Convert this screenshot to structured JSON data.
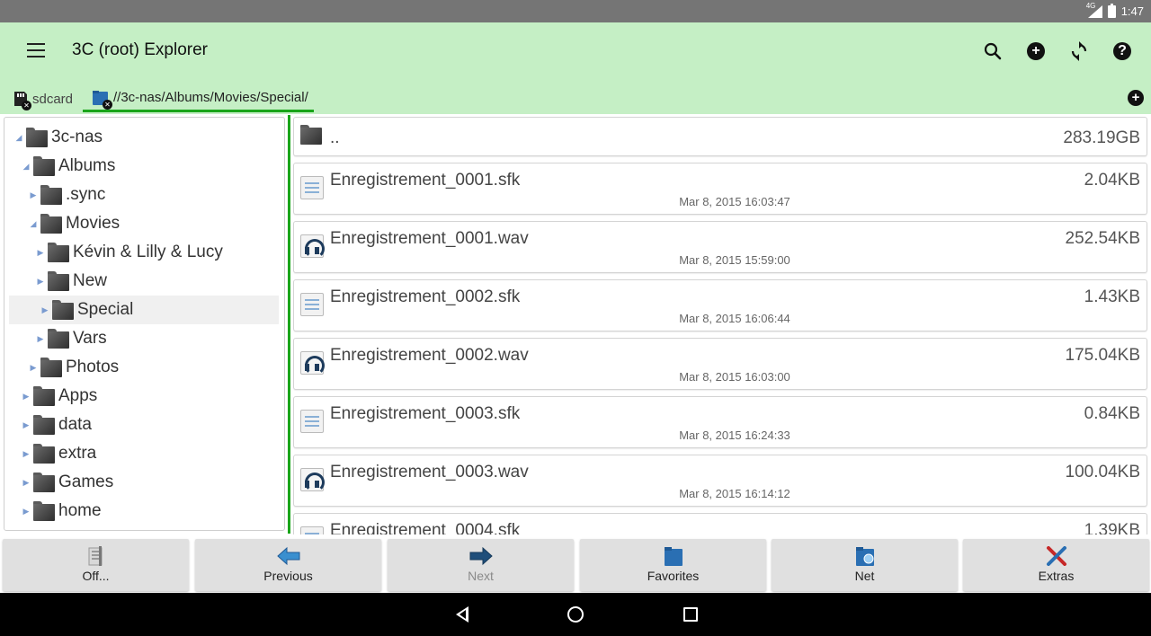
{
  "status_bar": {
    "network": "4G",
    "time": "1:47"
  },
  "app_bar": {
    "title": "3C (root) Explorer",
    "icons": [
      "menu-icon",
      "search-icon",
      "add-icon",
      "refresh-icon",
      "help-icon"
    ]
  },
  "tabs": [
    {
      "label": "sdcard"
    },
    {
      "label": "//3c-nas/Albums/Movies/Special/"
    }
  ],
  "tree": [
    {
      "label": "3c-nas",
      "expanded": true
    },
    {
      "label": "Albums",
      "expanded": true
    },
    {
      "label": ".sync",
      "expanded": false
    },
    {
      "label": "Movies",
      "expanded": true
    },
    {
      "label": "Kévin & Lilly & Lucy",
      "expanded": false
    },
    {
      "label": "New",
      "expanded": false
    },
    {
      "label": "Special",
      "expanded": false,
      "selected": true
    },
    {
      "label": "Vars",
      "expanded": false
    },
    {
      "label": "Photos",
      "expanded": false
    },
    {
      "label": "Apps",
      "expanded": false
    },
    {
      "label": "data",
      "expanded": false
    },
    {
      "label": "extra",
      "expanded": false
    },
    {
      "label": "Games",
      "expanded": false
    },
    {
      "label": "home",
      "expanded": false
    }
  ],
  "files": [
    {
      "name": "..",
      "size": "283.19GB",
      "date": "",
      "type": "folder"
    },
    {
      "name": "Enregistrement_0001.sfk",
      "size": "2.04KB",
      "date": "Mar 8, 2015 16:03:47",
      "type": "sfk"
    },
    {
      "name": "Enregistrement_0001.wav",
      "size": "252.54KB",
      "date": "Mar 8, 2015 15:59:00",
      "type": "wav"
    },
    {
      "name": "Enregistrement_0002.sfk",
      "size": "1.43KB",
      "date": "Mar 8, 2015 16:06:44",
      "type": "sfk"
    },
    {
      "name": "Enregistrement_0002.wav",
      "size": "175.04KB",
      "date": "Mar 8, 2015 16:03:00",
      "type": "wav"
    },
    {
      "name": "Enregistrement_0003.sfk",
      "size": "0.84KB",
      "date": "Mar 8, 2015 16:24:33",
      "type": "sfk"
    },
    {
      "name": "Enregistrement_0003.wav",
      "size": "100.04KB",
      "date": "Mar 8, 2015 16:14:12",
      "type": "wav"
    },
    {
      "name": "Enregistrement_0004.sfk",
      "size": "1.39KB",
      "date": "",
      "type": "sfk"
    }
  ],
  "bottom_buttons": [
    {
      "label": "Off...",
      "icon": "operations-icon",
      "enabled": true
    },
    {
      "label": "Previous",
      "icon": "arrow-left-icon",
      "enabled": true
    },
    {
      "label": "Next",
      "icon": "arrow-right-icon",
      "enabled": false
    },
    {
      "label": "Favorites",
      "icon": "favorites-folder-icon",
      "enabled": true
    },
    {
      "label": "Net",
      "icon": "network-folder-icon",
      "enabled": true
    },
    {
      "label": "Extras",
      "icon": "tools-icon",
      "enabled": true
    }
  ],
  "colors": {
    "accent": "#1aa51a",
    "appbar": "#c5efc5",
    "statusbar": "#757575"
  }
}
